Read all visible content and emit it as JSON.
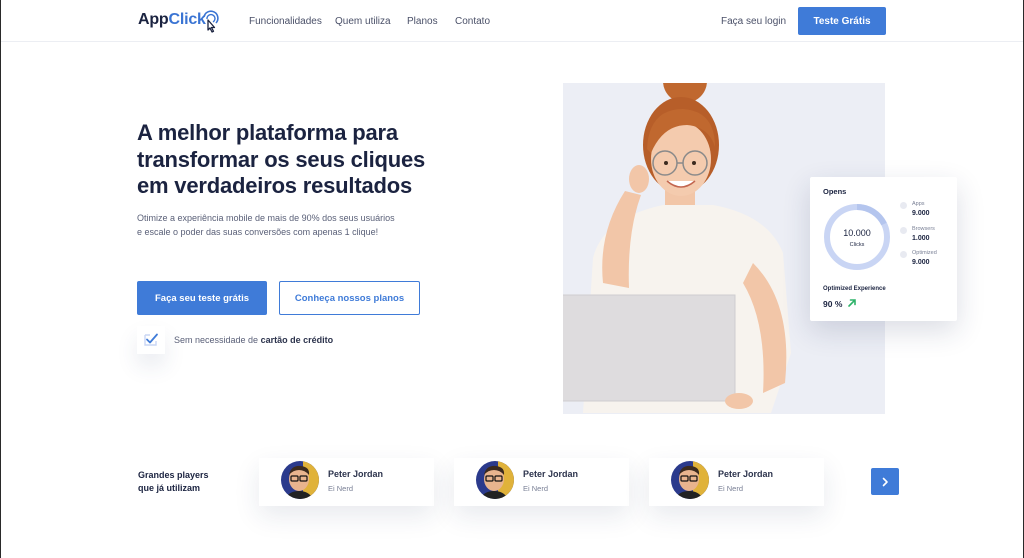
{
  "brand": {
    "name_part1": "App",
    "name_part2": "Click",
    "accent": "#3f7bd8",
    "dark": "#1b2340"
  },
  "nav": {
    "items": [
      {
        "label": "Funcionalidades"
      },
      {
        "label": "Quem utiliza"
      },
      {
        "label": "Planos"
      },
      {
        "label": "Contato"
      }
    ],
    "login_label": "Faça seu login",
    "cta_label": "Teste Grátis"
  },
  "hero": {
    "title_line1": "A melhor plataforma para",
    "title_line2": "transformar os seus cliques",
    "title_line3": "em verdadeiros resultados",
    "subtitle_line1": "Otimize a experiência mobile de mais de 90% dos seus usuários",
    "subtitle_line2": "e escale o poder das suas conversões com apenas 1 clique!",
    "primary_button": "Faça seu teste grátis",
    "secondary_button": "Conheça nossos planos",
    "note_prefix": "Sem necessidade de",
    "note_bold": "cartão de crédito"
  },
  "stats_card": {
    "title": "Opens",
    "ring_value": "10.000",
    "ring_label": "Clicks",
    "legend": [
      {
        "name": "Apps",
        "value": "9.000"
      },
      {
        "name": "Browsers",
        "value": "1.000"
      },
      {
        "name": "Optimized",
        "value": "9.000"
      }
    ],
    "optimized_label": "Optimized Experience",
    "optimized_value": "90 %",
    "trend_icon": "arrow-up-right-icon",
    "trend_color": "#2fb36a",
    "ring_color": "#c9d5f4"
  },
  "players": {
    "label_line1": "Grandes players",
    "label_line2": "que já utilizam",
    "cards": [
      {
        "name": "Peter Jordan",
        "role": "Ei Nerd"
      },
      {
        "name": "Peter Jordan",
        "role": "Ei Nerd"
      },
      {
        "name": "Peter Jordan",
        "role": "Ei Nerd"
      }
    ],
    "next_icon": "chevron-right-icon"
  }
}
